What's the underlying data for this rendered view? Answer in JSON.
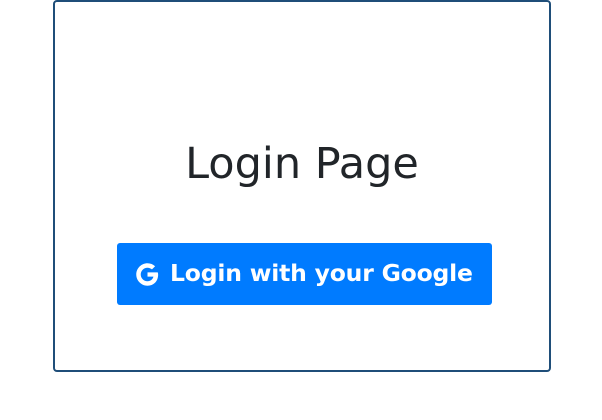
{
  "login": {
    "title": "Login Page",
    "google_button_label": "Login with your Google",
    "google_icon": "google-g-icon"
  },
  "colors": {
    "card_border": "#1f4e79",
    "title_text": "#212529",
    "button_bg": "#007bff",
    "button_text": "#ffffff"
  }
}
